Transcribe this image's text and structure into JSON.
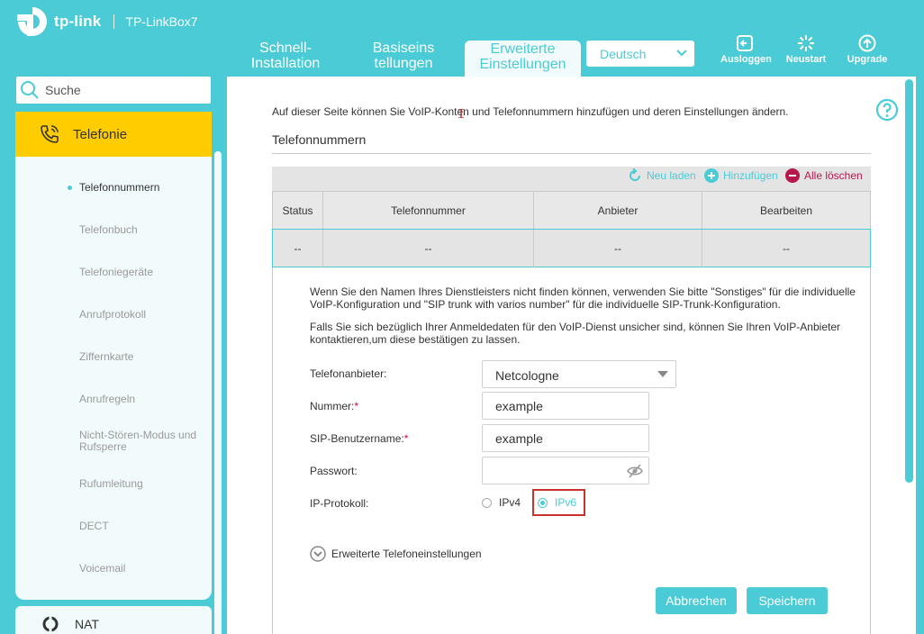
{
  "header": {
    "brand": "tp-link",
    "model": "TP-LinkBox7",
    "tabs": [
      {
        "line1": "Schnell-",
        "line2": "Installation"
      },
      {
        "line1": "Basiseins",
        "line2": "tellungen"
      },
      {
        "line1": "Erweiterte",
        "line2": "Einstellungen"
      }
    ],
    "language": "Deutsch",
    "tools": [
      {
        "label": "Ausloggen",
        "icon": "logout-icon"
      },
      {
        "label": "Neustart",
        "icon": "reboot-icon"
      },
      {
        "label": "Upgrade",
        "icon": "upgrade-icon"
      }
    ]
  },
  "sidebar": {
    "search_placeholder": "Suche",
    "active_section": "Telefonie",
    "items": [
      "Telefonnummern",
      "Telefonbuch",
      "Telefoniegeräte",
      "Anrufprotokoll",
      "Ziffernkarte",
      "Anrufregeln",
      "Nicht-Stören-Modus und Rufsperre",
      "Rufumleitung",
      "DECT",
      "Voicemail"
    ],
    "next_section": "NAT"
  },
  "main": {
    "description": "Auf dieser Seite können Sie VoIP-Konten und Telefonnummern hinzufügen und deren Einstellungen ändern.",
    "section_title": "Telefonnummern",
    "toolbar": {
      "reload": "Neu laden",
      "add": "Hinzufügen",
      "delete_all": "Alle löschen"
    },
    "table": {
      "headers": [
        "Status",
        "Telefonnummer",
        "Anbieter",
        "Bearbeiten"
      ],
      "row": [
        "--",
        "--",
        "--",
        "--"
      ]
    },
    "form": {
      "note1": "Wenn Sie den Namen Ihres Dienstleisters nicht finden können, verwenden Sie bitte \"Sonstiges\" für die individuelle VoIP-Konfiguration und \"SIP trunk with varios number\" für die individuelle SIP-Trunk-Konfiguration.",
      "note2": "Falls Sie sich bezüglich Ihrer Anmeldedaten für den VoIP-Dienst unsicher sind, können Sie Ihren VoIP-Anbieter kontaktieren,um diese bestätigen zu lassen.",
      "provider_label": "Telefonanbieter:",
      "provider_value": "Netcologne",
      "number_label": "Nummer:",
      "number_value": "example",
      "sip_user_label": "SIP-Benutzername:",
      "sip_user_value": "example",
      "password_label": "Passwort:",
      "password_value": "",
      "ip_label": "IP-Protokoll:",
      "ip_options": [
        "IPv4",
        "IPv6"
      ],
      "ip_selected": "IPv6",
      "required_mark": "*",
      "advanced": "Erweiterte Telefoneinstellungen",
      "cancel": "Abbrechen",
      "save": "Speichern"
    }
  },
  "colors": {
    "accent": "#4acbd6",
    "highlight": "#ffcc00",
    "danger": "#c8342b"
  }
}
